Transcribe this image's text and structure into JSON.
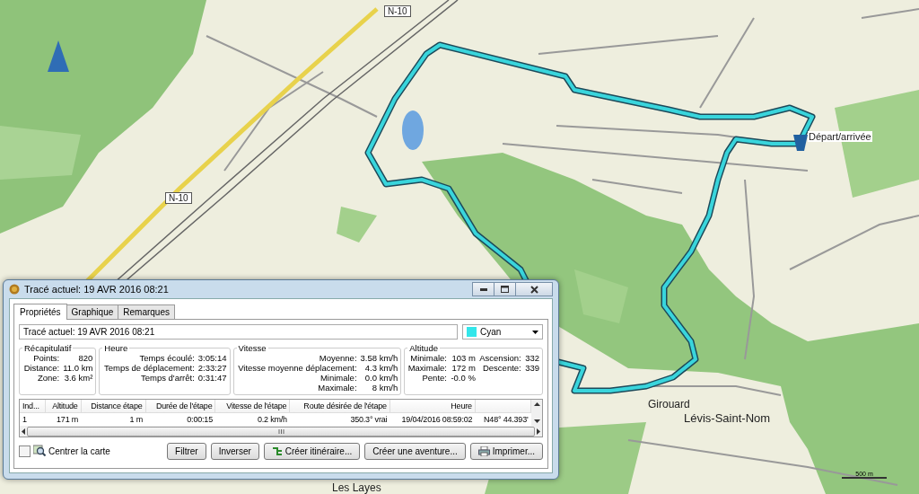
{
  "map": {
    "labels": [
      {
        "text": "N-10",
        "kind": "road"
      },
      {
        "text": "Départ/arrivée",
        "kind": "poi"
      },
      {
        "text": "N-10",
        "kind": "road"
      },
      {
        "text": "Girouard",
        "kind": "place"
      },
      {
        "text": "Lévis-Saint-Nom",
        "kind": "town"
      },
      {
        "text": "Les Layes",
        "kind": "place"
      }
    ],
    "scale": "500 m"
  },
  "window": {
    "title": "Tracé actuel: 19 AVR 2016 08:21"
  },
  "tabs": [
    {
      "label": "Propriétés",
      "selected": true
    },
    {
      "label": "Graphique",
      "selected": false
    },
    {
      "label": "Remarques",
      "selected": false
    }
  ],
  "track_name": {
    "value": "Tracé actuel: 19 AVR 2016 08:21"
  },
  "color_select": {
    "value": "Cyan",
    "color": "#33e6ea"
  },
  "groups": [
    {
      "title": "Récapitulatif",
      "kind": "single",
      "rows": [
        {
          "label": "Points:",
          "value": "820"
        },
        {
          "label": "Distance:",
          "value": "11.0 km"
        },
        {
          "label": "Zone:",
          "value": "3.6 km²"
        }
      ]
    },
    {
      "title": "Heure",
      "kind": "single",
      "rows": [
        {
          "label": "Temps écoulé:",
          "value": "3:05:14"
        },
        {
          "label": "Temps de déplacement:",
          "value": "2:33:27"
        },
        {
          "label": "Temps d'arrêt:",
          "value": "0:31:47"
        }
      ]
    },
    {
      "title": "Vitesse",
      "kind": "single",
      "rows": [
        {
          "label": "Moyenne:",
          "value": "3.58 km/h"
        },
        {
          "label": "Vitesse moyenne déplacement:",
          "value": "4.3 km/h"
        },
        {
          "label": "Minimale:",
          "value": "0.0 km/h"
        },
        {
          "label": "Maximale:",
          "value": "8 km/h"
        }
      ]
    },
    {
      "title": "Altitude",
      "kind": "paired",
      "rows": [
        {
          "label": "Minimale:",
          "value": "103 m"
        },
        {
          "label": "Ascension:",
          "value": "332"
        },
        {
          "label": "Maximale:",
          "value": "172 m"
        },
        {
          "label": "Descente:",
          "value": "339"
        },
        {
          "label": "Pente:",
          "value": "-0.0 %"
        }
      ]
    }
  ],
  "table": {
    "columns": [
      "Ind...",
      "Altitude",
      "Distance étape",
      "Durée de l'étape",
      "Vitesse de l'étape",
      "Route désirée de l'étape",
      "Heure"
    ],
    "rows": [
      [
        "1",
        "171 m",
        "1 m",
        "0:00:15",
        "0.2 km/h",
        "350.3° vrai",
        "19/04/2016 08:59:02",
        "N48° 44.393'"
      ]
    ]
  },
  "center_map": {
    "label": "Centrer la carte",
    "checked": false
  },
  "buttons": [
    {
      "label": "Filtrer",
      "kind": "plain"
    },
    {
      "label": "Inverser",
      "kind": "plain"
    },
    {
      "label": "Créer itinéraire...",
      "kind": "route"
    },
    {
      "label": "Créer une aventure...",
      "kind": "plain"
    },
    {
      "label": "Imprimer...",
      "kind": "print"
    }
  ]
}
